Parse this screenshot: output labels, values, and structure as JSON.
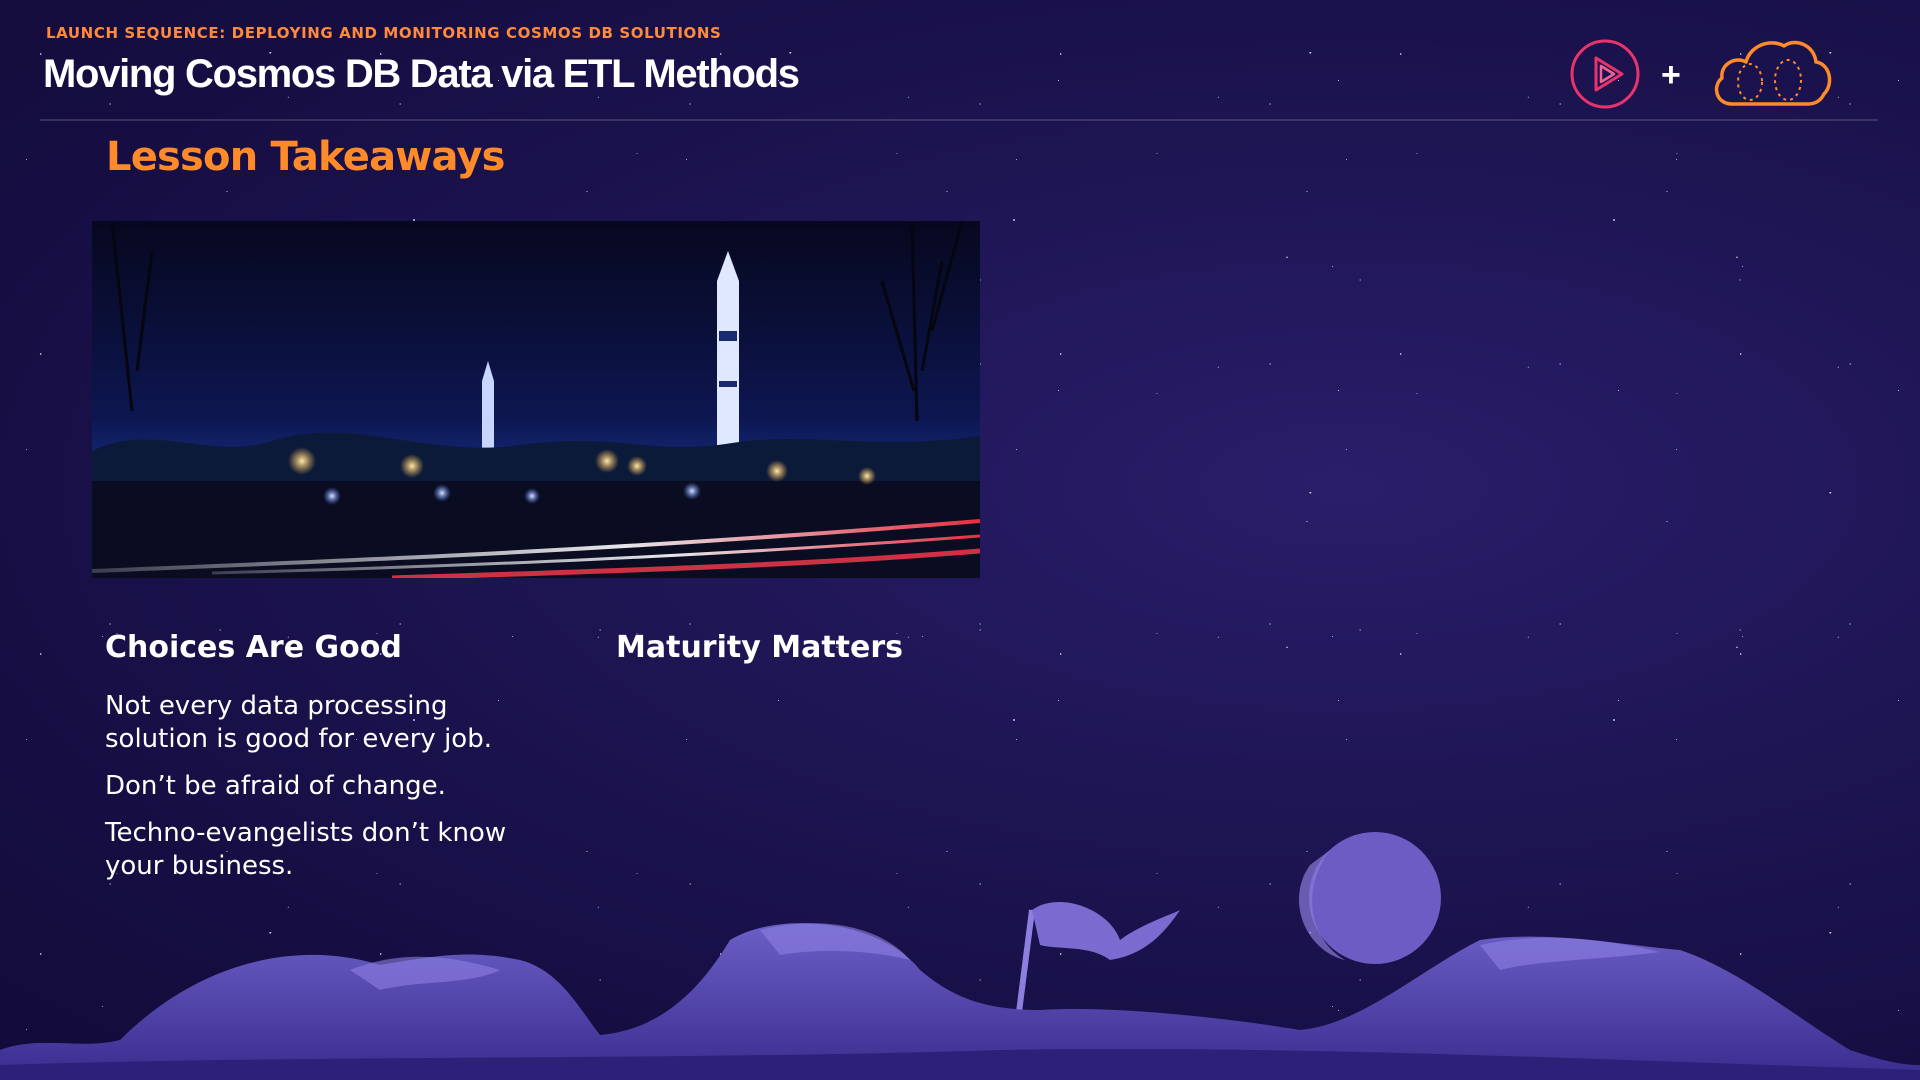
{
  "header": {
    "kicker": "LAUNCH SEQUENCE: DEPLOYING AND MONITORING COSMOS DB SOLUTIONS",
    "title": "Moving Cosmos DB Data via ETL Methods",
    "logo_separator": "+",
    "logos": [
      "play-icon",
      "cloud-icon"
    ]
  },
  "slide": {
    "section_heading": "Lesson Takeaways",
    "photo": "night-rocket-park-photo",
    "column1": {
      "heading": "Choices Are Good",
      "bullets": [
        "Not every data processing solution is good for every job.",
        "Don’t be afraid of change.",
        "Techno-evangelists don’t know your business."
      ]
    },
    "column2": {
      "heading": "Maturity Matters"
    }
  },
  "colors": {
    "background": "#1b1350",
    "accent_orange": "#ff8a2a",
    "play_logo": "#e8336d",
    "cloud_logo": "#ff8a2a",
    "text": "#ffffff"
  }
}
